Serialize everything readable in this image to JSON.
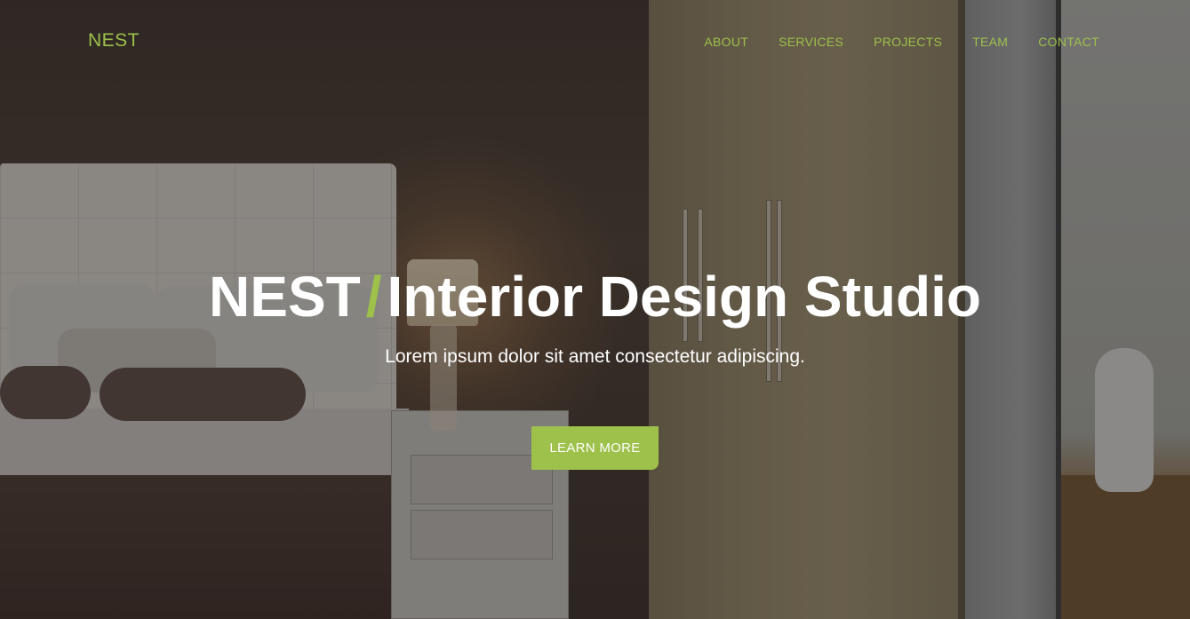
{
  "brand": {
    "name": "NEST"
  },
  "nav": {
    "items": [
      {
        "label": "ABOUT"
      },
      {
        "label": "SERVICES"
      },
      {
        "label": "PROJECTS"
      },
      {
        "label": "TEAM"
      },
      {
        "label": "CONTACT"
      }
    ]
  },
  "hero": {
    "title_strong": "NEST",
    "title_separator": "/",
    "title_rest": "Interior Design Studio",
    "subtitle": "Lorem ipsum dolor sit amet consectetur adipiscing.",
    "cta_label": "LEARN MORE"
  },
  "colors": {
    "accent": "#9dc14a",
    "text": "#ffffff"
  }
}
